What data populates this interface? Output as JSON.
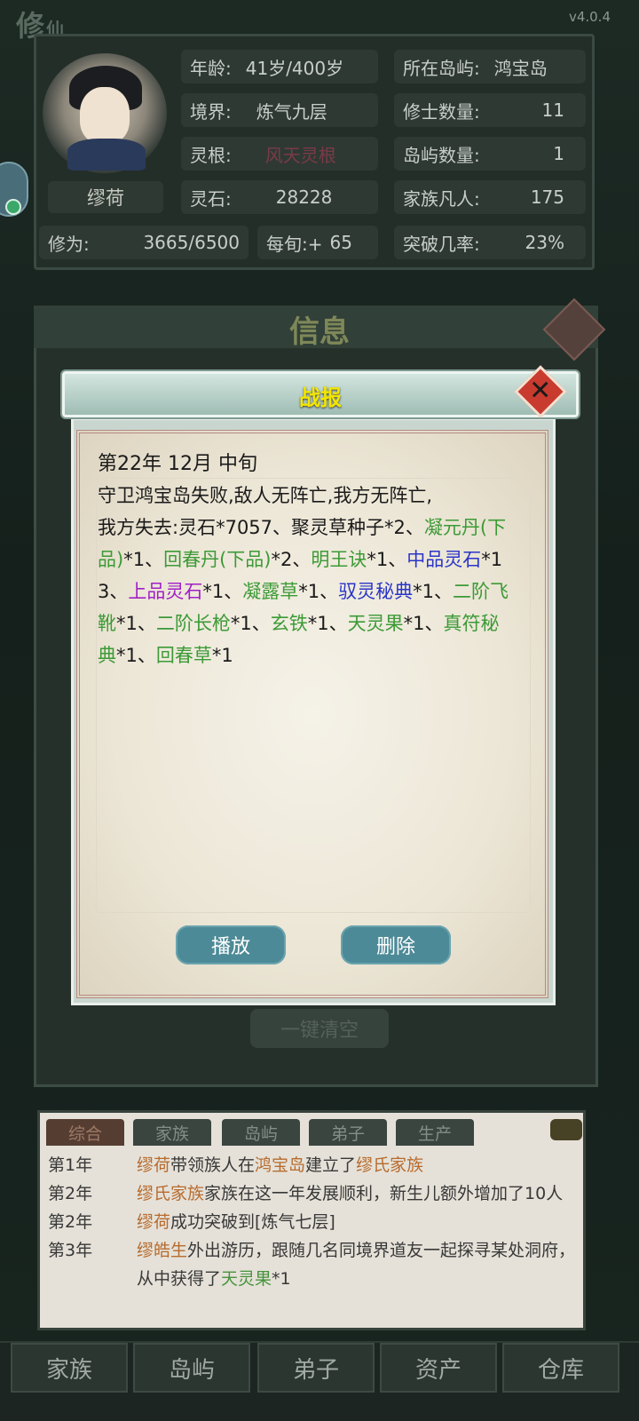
{
  "app": {
    "logo_main": "修",
    "logo_sub": "仙",
    "version": "v4.0.4"
  },
  "stats": {
    "age_label": "年龄:",
    "age_value": "41岁/400岁",
    "island_label": "所在岛屿:",
    "island_value": "鸿宝岛",
    "realm_label": "境界:",
    "realm_value": "炼气九层",
    "cultivators_label": "修士数量:",
    "cultivators_value": "11",
    "root_label": "灵根:",
    "root_value": "风天灵根",
    "islands_label": "岛屿数量:",
    "islands_value": "1",
    "name": "缪荷",
    "stones_label": "灵石:",
    "stones_value": "28228",
    "mortals_label": "家族凡人:",
    "mortals_value": "175",
    "cultivation_label": "修为:",
    "cultivation_value": "3665/6500",
    "per_xun_label": "每旬:+",
    "per_xun_value": "65",
    "breakthrough_label": "突破几率:",
    "breakthrough_value": "23%"
  },
  "info_panel": {
    "title": "信息",
    "clear_all": "一键清空"
  },
  "modal": {
    "title": "战报",
    "date": "第22年 12月 中旬",
    "line1": "守卫鸿宝岛失败,敌人无阵亡,我方无阵亡,",
    "lost_label": "我方失去:",
    "items": [
      {
        "text": "灵石",
        "qty": "*7057",
        "color": "k"
      },
      {
        "text": "聚灵草种子",
        "qty": "*2",
        "color": "k"
      },
      {
        "text": "凝元丹(下品)",
        "qty": "*1",
        "color": "g"
      },
      {
        "text": "回春丹(下品)",
        "qty": "*2",
        "color": "g"
      },
      {
        "text": "明王诀",
        "qty": "*1",
        "color": "g"
      },
      {
        "text": "中品灵石",
        "qty": "*13",
        "color": "b"
      },
      {
        "text": "上品灵石",
        "qty": "*1",
        "color": "p"
      },
      {
        "text": "凝露草",
        "qty": "*1",
        "color": "g"
      },
      {
        "text": "驭灵秘典",
        "qty": "*1",
        "color": "b"
      },
      {
        "text": "二阶飞靴",
        "qty": "*1",
        "color": "g"
      },
      {
        "text": "二阶长枪",
        "qty": "*1",
        "color": "g"
      },
      {
        "text": "玄铁",
        "qty": "*1",
        "color": "g"
      },
      {
        "text": "天灵果",
        "qty": "*1",
        "color": "g"
      },
      {
        "text": "真符秘典",
        "qty": "*1",
        "color": "g"
      },
      {
        "text": "回春草",
        "qty": "*1",
        "color": "g"
      }
    ],
    "separator": "、",
    "play_button": "播放",
    "delete_button": "删除"
  },
  "log_tabs": [
    "综合",
    "家族",
    "岛屿",
    "弟子",
    "生产"
  ],
  "log": {
    "r1_year": "第1年",
    "r1_a": "缪荷",
    "r1_b": "带领族人在",
    "r1_c": "鸿宝岛",
    "r1_d": "建立了",
    "r1_e": "缪氏家族",
    "r2_year": "第2年",
    "r2_a": "缪氏家族",
    "r2_b": "家族在这一年发展顺利，新生儿额外增加了10人",
    "r3_year": "第2年",
    "r3_a": "缪荷",
    "r3_b": "成功突破到[炼气七层]",
    "r4_year": "第3年",
    "r4_a": "缪皓生",
    "r4_b": "外出游历，跟随几名同境界道友一起探寻某处洞府，从中获得了",
    "r4_c": "天灵果",
    "r4_d": "*1"
  },
  "nav": [
    "家族",
    "岛屿",
    "弟子",
    "资产",
    "仓库"
  ]
}
